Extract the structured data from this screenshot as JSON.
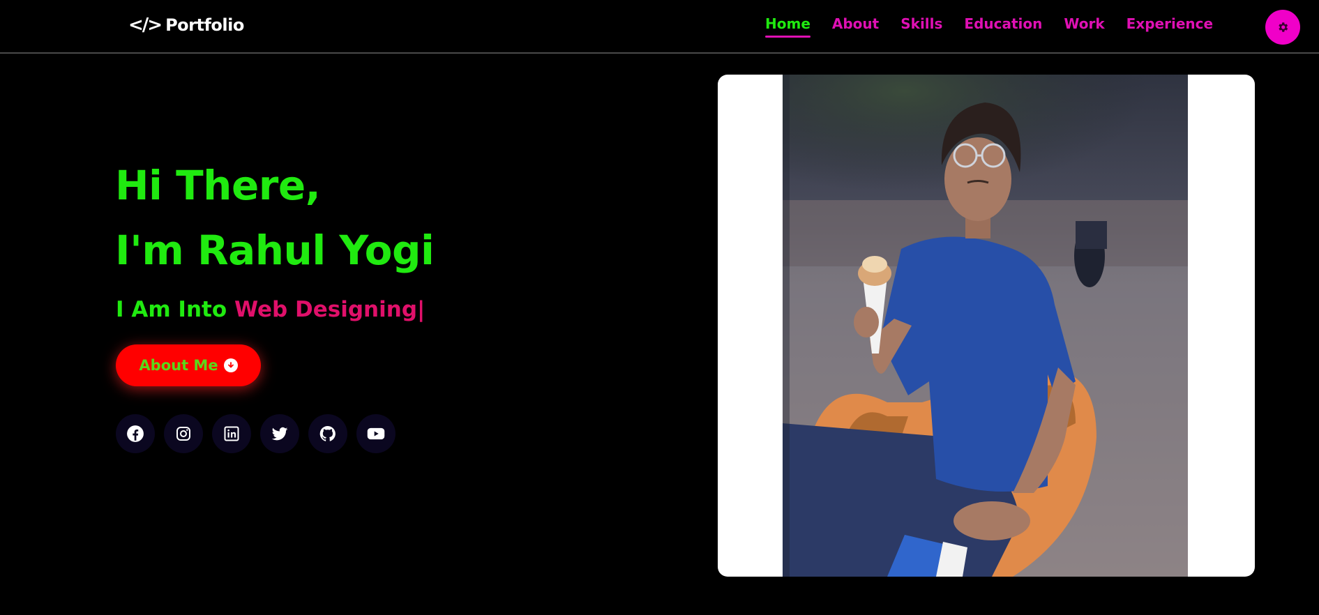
{
  "header": {
    "logo_text": "Portfolio",
    "logo_icon": "</>",
    "nav": [
      {
        "label": "Home",
        "active": true
      },
      {
        "label": "About"
      },
      {
        "label": "Skills"
      },
      {
        "label": "Education"
      },
      {
        "label": "Work"
      },
      {
        "label": "Experience"
      }
    ],
    "theme_toggle_icon": "gear-icon"
  },
  "hero": {
    "line1": "Hi There,",
    "line2": "I'm Rahul Yogi",
    "subtitle_prefix": "I Am Into ",
    "subtitle_highlight": "Web Designing",
    "cursor": "|",
    "button_label": "About Me",
    "button_icon": "arrow-down-circle-icon"
  },
  "socials": [
    "facebook-icon",
    "instagram-icon",
    "linkedin-icon",
    "twitter-icon",
    "github-icon",
    "youtube-icon"
  ],
  "colors": {
    "background": "#000000",
    "accent_green": "#20ea10",
    "accent_pink": "#e010b4",
    "button_red": "#ff0000"
  }
}
